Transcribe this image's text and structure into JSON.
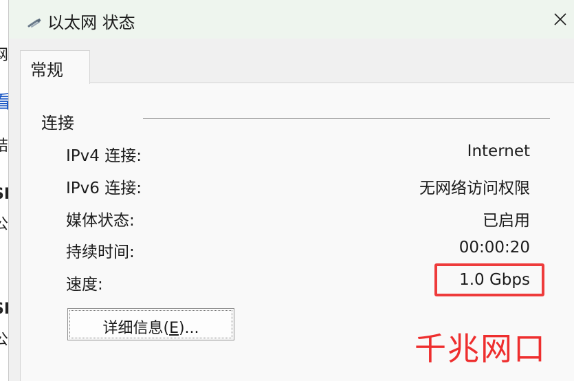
{
  "window": {
    "title": "以太网 状态",
    "icon": "network-cable-icon",
    "close_icon": "close-icon"
  },
  "tabs": [
    {
      "label": "常规",
      "selected": true
    }
  ],
  "group": {
    "title": "连接"
  },
  "rows": [
    {
      "label": "IPv4 连接:",
      "value": "Internet"
    },
    {
      "label": "IPv6 连接:",
      "value": "无网络访问权限"
    },
    {
      "label": "媒体状态:",
      "value": "已启用"
    },
    {
      "label": "持续时间:",
      "value": "00:00:20"
    },
    {
      "label": "速度:",
      "value": "1.0 Gbps"
    }
  ],
  "details_button": {
    "prefix": "详细信息(",
    "mnemonic": "E",
    "suffix": ")..."
  },
  "annotation": {
    "text": "千兆网口",
    "color": "#ee2e2e"
  },
  "background_window": {
    "glyphs": [
      "网",
      "看",
      "结",
      "SH",
      "公",
      "SH",
      "公"
    ]
  }
}
